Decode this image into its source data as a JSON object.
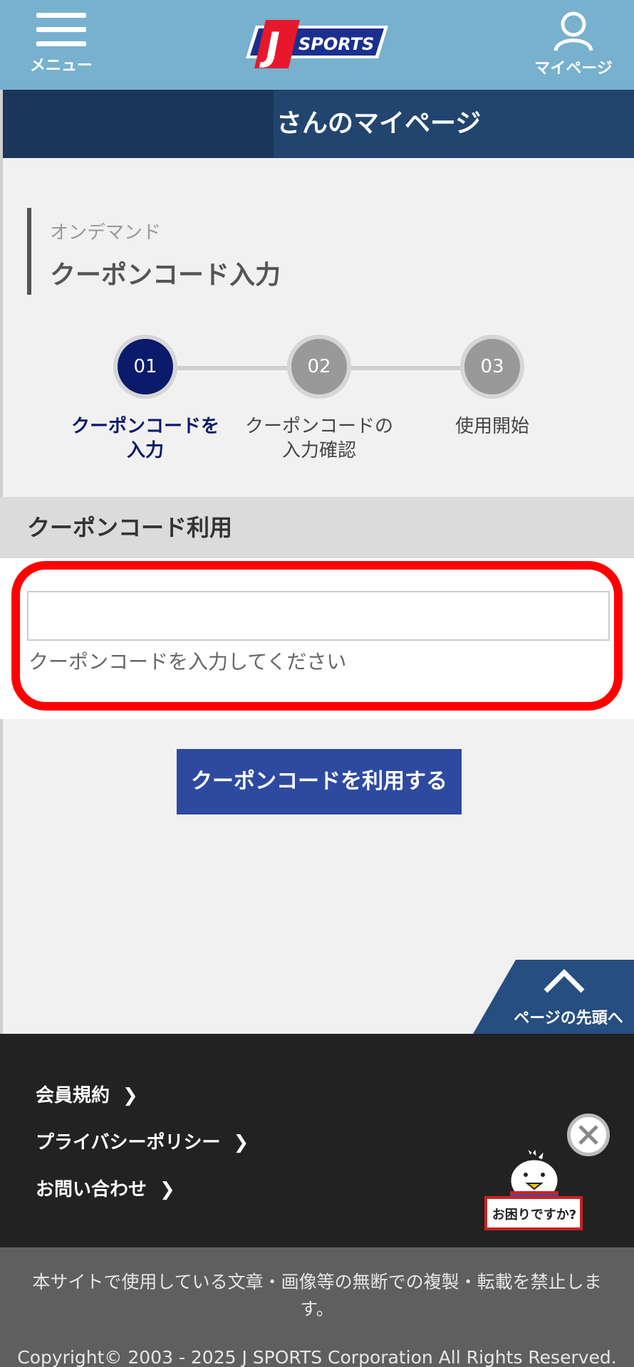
{
  "header": {
    "menu_label": "メニュー",
    "logo_text": "SPORTS",
    "logo_letter": "J",
    "mypage_label": "マイページ",
    "page_title": "さんのマイページ"
  },
  "heading": {
    "category": "オンデマンド",
    "title": "クーポンコード入力"
  },
  "steps": [
    {
      "num": "01",
      "label_line1": "クーポンコードを",
      "label_line2": "入力",
      "active": true
    },
    {
      "num": "02",
      "label_line1": "クーポンコードの",
      "label_line2": "入力確認",
      "active": false
    },
    {
      "num": "03",
      "label_line1": "使用開始",
      "label_line2": "",
      "active": false
    }
  ],
  "coupon": {
    "section_title": "クーポンコード利用",
    "input_value": "",
    "hint": "クーポンコードを入力してください",
    "submit_label": "クーポンコードを利用する"
  },
  "page_top_label": "ページの先頭へ",
  "footer": {
    "links": [
      "会員規約",
      "プライバシーポリシー",
      "お問い合わせ"
    ],
    "help_label": "お困りですか?",
    "notice": "本サイトで使用している文章・画像等の無断での複製・転載を禁止します。",
    "copyright": "Copyright© 2003 - 2025 J SPORTS Corporation All Rights Reserved."
  },
  "colors": {
    "header_bg": "#77b1cd",
    "title_bar": "#22456f",
    "active_step": "#0c1a6b",
    "button": "#2d4aa0",
    "highlight": "#ff0000",
    "footer_bg": "#222222"
  }
}
